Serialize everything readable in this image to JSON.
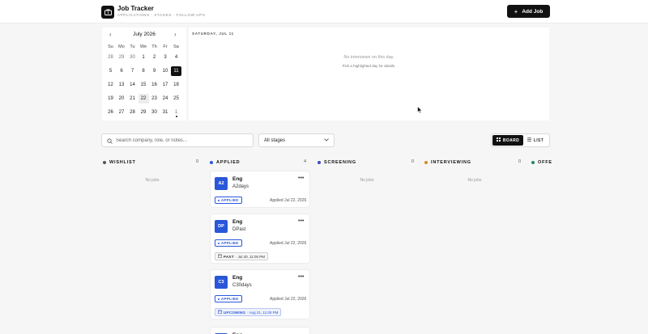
{
  "app": {
    "title": "Job Tracker",
    "subtitle": "APPLICATIONS · STAGES · FOLLOW-UPS",
    "add_label": "Add Job",
    "logo_icon": "briefcase-icon"
  },
  "calendar": {
    "month_label": "July 2026",
    "prev_icon": "chevron-left-icon",
    "next_icon": "chevron-right-icon",
    "weekdays": [
      "Su",
      "Mo",
      "Tu",
      "We",
      "Th",
      "Fr",
      "Sa"
    ],
    "weeks": [
      [
        "28",
        "29",
        "30",
        "1",
        "2",
        "3",
        "4"
      ],
      [
        "5",
        "6",
        "7",
        "8",
        "9",
        "10",
        "11"
      ],
      [
        "12",
        "13",
        "14",
        "15",
        "16",
        "17",
        "18"
      ],
      [
        "19",
        "20",
        "21",
        "22",
        "23",
        "24",
        "25"
      ],
      [
        "26",
        "27",
        "28",
        "29",
        "30",
        "31",
        "1"
      ]
    ],
    "selected_day": "11",
    "today_day": "22"
  },
  "day_panel": {
    "date_label": "SATURDAY, JUL 11",
    "empty_text": "No interviews on this day.",
    "hint_text": "Pick a highlighted day for details."
  },
  "toolbar": {
    "search_placeholder": "Search company, role, or notes...",
    "stage_filter": "All stages",
    "board_label": "BOARD",
    "list_label": "LIST"
  },
  "columns": [
    {
      "name": "WISHLIST",
      "count": "0",
      "color": "#555555",
      "empty": "No jobs"
    },
    {
      "name": "APPLIED",
      "count": "4",
      "color": "#2a57d9",
      "empty": ""
    },
    {
      "name": "SCREENING",
      "count": "0",
      "color": "#3b4fc4",
      "empty": "No jobs"
    },
    {
      "name": "INTERVIEWING",
      "count": "0",
      "color": "#d98b1f",
      "empty": "No jobs"
    },
    {
      "name": "OFFE",
      "count": "",
      "color": "#1f8a5a",
      "empty": ""
    }
  ],
  "cards": [
    {
      "initials": "A2",
      "role": "Eng",
      "company": "A2days",
      "stage": "APPLIED",
      "applied": "Applied Jul 22, 2026"
    },
    {
      "initials": "DP",
      "role": "Eng",
      "company": "DPast",
      "stage": "APPLIED",
      "applied": "Applied Jul 22, 2026",
      "interview_kind": "PAST",
      "interview_when": "· Jul 20, 11:00 PM"
    },
    {
      "initials": "C3",
      "role": "Eng",
      "company": "C30days",
      "stage": "APPLIED",
      "applied": "Applied Jul 22, 2026",
      "interview_kind": "UPCOMING",
      "interview_when": "· Aug 21, 11:00 PM"
    },
    {
      "role": "Eng"
    }
  ]
}
